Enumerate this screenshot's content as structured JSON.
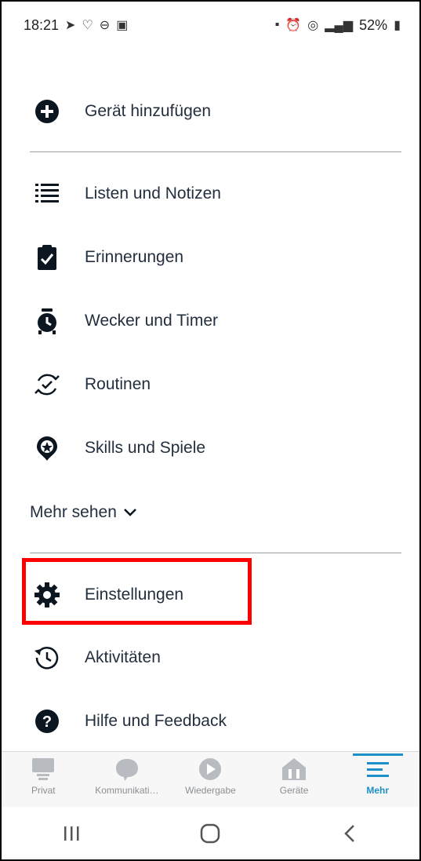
{
  "status_bar": {
    "time": "18:21",
    "battery": "52%"
  },
  "menu": {
    "add_device": "Gerät hinzufügen",
    "items": [
      {
        "label": "Listen und Notizen",
        "icon": "list-icon"
      },
      {
        "label": "Erinnerungen",
        "icon": "clipboard-check-icon"
      },
      {
        "label": "Wecker und Timer",
        "icon": "alarm-clock-icon"
      },
      {
        "label": "Routinen",
        "icon": "routine-icon"
      },
      {
        "label": "Skills und Spiele",
        "icon": "skills-icon"
      }
    ],
    "more_label": "Mehr sehen",
    "bottom_items": [
      {
        "label": "Einstellungen",
        "icon": "gear-icon"
      },
      {
        "label": "Aktivitäten",
        "icon": "history-icon"
      },
      {
        "label": "Hilfe und Feedback",
        "icon": "help-icon"
      }
    ]
  },
  "bottom_nav": {
    "tabs": [
      {
        "label": "Privat",
        "icon": "home-device-icon"
      },
      {
        "label": "Kommunikati…",
        "icon": "chat-icon"
      },
      {
        "label": "Wiedergabe",
        "icon": "play-icon"
      },
      {
        "label": "Geräte",
        "icon": "devices-icon"
      },
      {
        "label": "Mehr",
        "icon": "menu-icon",
        "active": true
      }
    ]
  },
  "colors": {
    "accent": "#1e8fc6",
    "text": "#232f3e",
    "highlight": "#ff0000",
    "inactive": "#8a8f94"
  }
}
